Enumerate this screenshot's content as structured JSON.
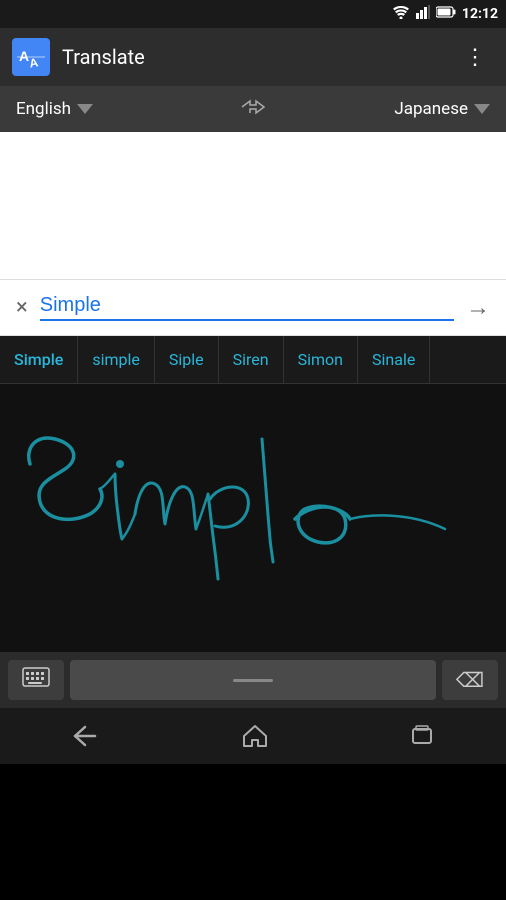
{
  "statusBar": {
    "time": "12:12",
    "wifiIcon": "wifi",
    "signalIcon": "signal",
    "batteryIcon": "battery"
  },
  "appBar": {
    "title": "Translate",
    "iconLabel": "TA",
    "overflowIcon": "⋮"
  },
  "languageBar": {
    "sourceLang": "English",
    "targetLang": "Japanese",
    "swapLabel": "( )"
  },
  "inputArea": {
    "inputValue": "Simple",
    "clearIcon": "×",
    "submitIcon": "→"
  },
  "suggestions": [
    "Simple",
    "simple",
    "Siple",
    "Siren",
    "Simon",
    "Sinale"
  ],
  "handwriting": {
    "description": "Handwritten 'Simple' in blue cursive"
  },
  "keyboardBar": {
    "keyboardIcon": "⌨",
    "backspaceIcon": "⌫"
  },
  "navBar": {
    "backLabel": "back",
    "homeLabel": "home",
    "recentsLabel": "recents"
  }
}
